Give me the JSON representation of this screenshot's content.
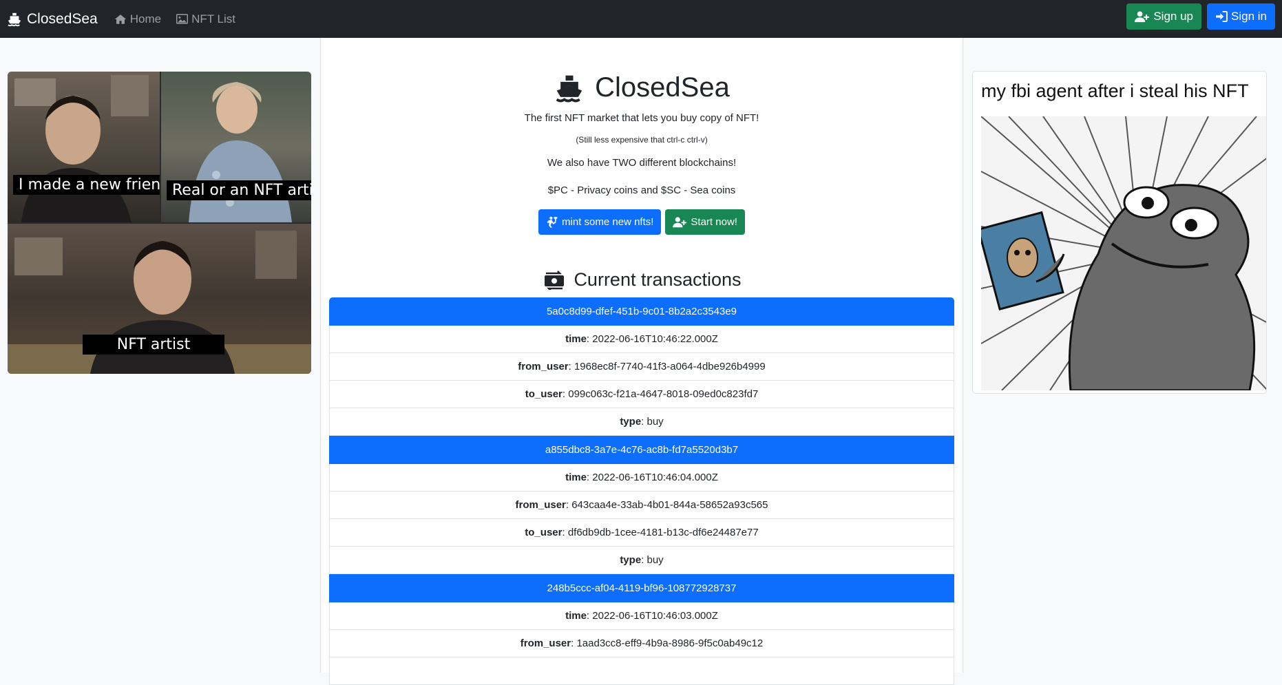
{
  "navbar": {
    "brand": "ClosedSea",
    "links": [
      "Home",
      "NFT List"
    ],
    "signup_label": "Sign up",
    "signin_label": "Sign in",
    "bg_color": "#212529"
  },
  "left_meme": {
    "captions": [
      "I made a new friend",
      "Real or an NFT artist?",
      "NFT artist"
    ]
  },
  "hero": {
    "title": "ClosedSea",
    "line1": "The first NFT market that lets you buy copy of NFT!",
    "line2": "(Still less expensive that ctrl-c ctrl-v)",
    "line3": "We also have TWO different blockchains!",
    "line4": "$PC - Privacy coins and $SC - Sea coins",
    "mint_button": "mint some new nfts!",
    "start_button": "Start now!"
  },
  "transactions": {
    "title": "Current transactions",
    "field_labels": {
      "time": "time",
      "from_user": "from_user",
      "to_user": "to_user",
      "type": "type"
    },
    "items": [
      {
        "id": "5a0c8d99-dfef-451b-9c01-8b2a2c3543e9",
        "time": "2022-06-16T10:46:22.000Z",
        "from_user": "1968ec8f-7740-41f3-a064-4dbe926b4999",
        "to_user": "099c063c-f21a-4647-8018-09ed0c823fd7",
        "type": "buy"
      },
      {
        "id": "a855dbc8-3a7e-4c76-ac8b-fd7a5520d3b7",
        "time": "2022-06-16T10:46:04.000Z",
        "from_user": "643caa4e-33ab-4b01-844a-58652a93c565",
        "to_user": "df6db9db-1cee-4181-b13c-df6e24487e77",
        "type": "buy"
      },
      {
        "id": "248b5ccc-af04-4119-bf96-108772928737",
        "time": "2022-06-16T10:46:03.000Z",
        "from_user": "1aad3cc8-eff9-4b9a-8986-9f5c0ab49c12"
      }
    ]
  },
  "right_meme": {
    "caption": "my fbi agent after i steal his NFT"
  },
  "colors": {
    "primary": "#0d6efd",
    "success": "#198754",
    "dark": "#212529"
  }
}
